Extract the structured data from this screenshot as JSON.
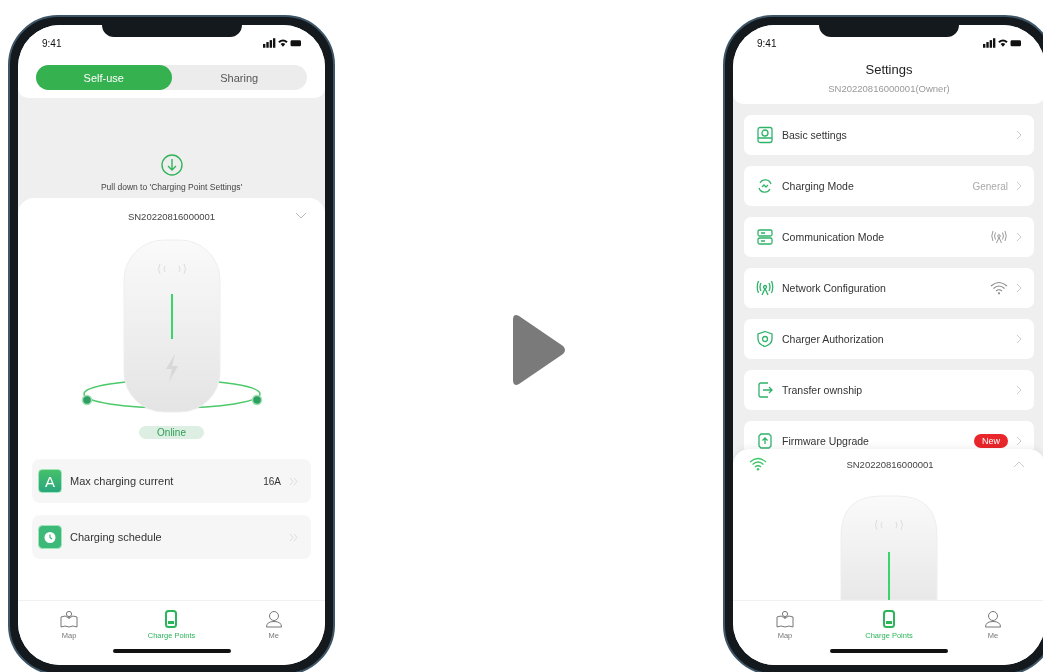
{
  "left_phone": {
    "status_bar": {
      "time": "9:41"
    },
    "segments": [
      {
        "label": "Self-use",
        "selected": true
      },
      {
        "label": "Sharing",
        "selected": false
      }
    ],
    "pull_hint": "Pull down to 'Charging Point Settings'",
    "serial": "SN20220816000001",
    "status_badge": "Online",
    "rows": [
      {
        "kind": "letter",
        "icon_text": "A",
        "label": "Max charging current",
        "value": "16A"
      },
      {
        "kind": "clock",
        "label": "Charging schedule"
      }
    ],
    "tabs": [
      {
        "label": "Map",
        "selected": false
      },
      {
        "label": "Charge Points",
        "selected": true
      },
      {
        "label": "Me",
        "selected": false
      }
    ]
  },
  "right_phone": {
    "status_bar": {
      "time": "9:41"
    },
    "title": "Settings",
    "subtitle": "SN20220816000001(Owner)",
    "rows": [
      {
        "kind": "plain",
        "label": "Basic settings"
      },
      {
        "kind": "value",
        "label": "Charging Mode",
        "value": "General"
      },
      {
        "kind": "antenna",
        "label": "Communication Mode"
      },
      {
        "kind": "wifi",
        "label": "Network Configuration"
      },
      {
        "kind": "plain",
        "label": "Charger Authorization"
      },
      {
        "kind": "plain",
        "label": "Transfer ownship"
      },
      {
        "kind": "badge",
        "label": "Firmware Upgrade",
        "badge": "New"
      }
    ],
    "sheet": {
      "serial": "SN20220816000001"
    },
    "tabs": [
      {
        "label": "Map",
        "selected": false
      },
      {
        "label": "Charge Points",
        "selected": true
      },
      {
        "label": "Me",
        "selected": false
      }
    ]
  }
}
